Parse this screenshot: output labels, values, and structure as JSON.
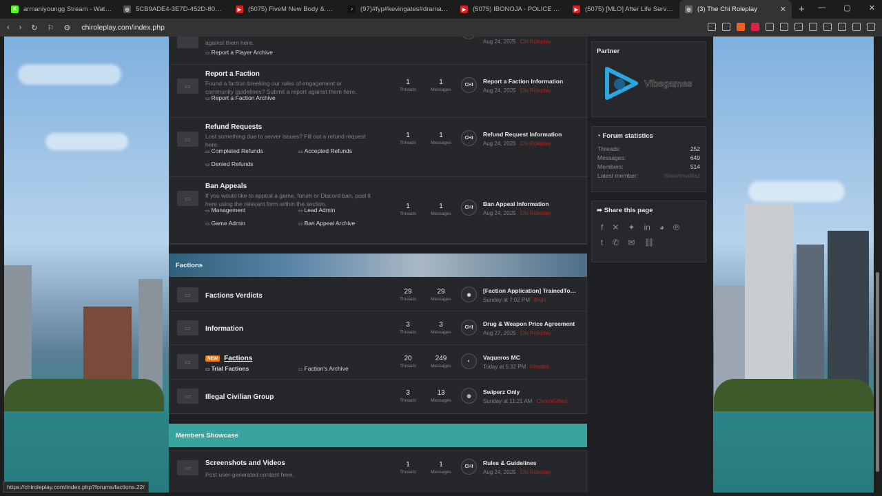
{
  "tabs": [
    {
      "title": "armaniyoungg Stream - Watch L",
      "fav_color": "#53fc18",
      "fav_text": "K",
      "muted": true
    },
    {
      "title": "5CB9ADE4-3E7D-452D-80EE-7A93E",
      "fav_color": "#555",
      "fav_text": "◎"
    },
    {
      "title": "(5075) FiveM New Body & Mask Co",
      "fav_color": "#e02020",
      "fav_text": "▶"
    },
    {
      "title": "(97)#fyp#kevingates#drama | Kevin",
      "fav_color": "#111",
      "fav_text": "♪"
    },
    {
      "title": "(5075) IBONOJA - POLICE ACADEMY",
      "fav_color": "#e02020",
      "fav_text": "▶"
    },
    {
      "title": "(5075) [MLO] After Life Services - Fi",
      "fav_color": "#e02020",
      "fav_text": "▶"
    },
    {
      "title": "(3) The Chi Roleplay",
      "fav_color": "#666",
      "fav_text": "◎",
      "active": true
    }
  ],
  "url": "chiroleplay.com/index.php",
  "status_url": "https://chiroleplay.com/index.php?forums/factions.22/",
  "stat_labels": {
    "threads": "Threads",
    "messages": "Messages"
  },
  "top_partial": {
    "desc": "against them here.",
    "sub": "Report a Player Archive",
    "date": "Aug 24, 2025",
    "user": "Chi Roleplay"
  },
  "nodes": [
    {
      "title": "Report a Faction",
      "desc": "Found a faction breaking our rules of engagement or community guidelines? Submit a report against them here.",
      "subs": [
        "Report a Faction Archive"
      ],
      "threads": "1",
      "messages": "1",
      "last_title": "Report a Faction Information",
      "last_date": "Aug 24, 2025",
      "last_user": "Chi Roleplay"
    },
    {
      "title": "Refund Requests",
      "desc": "Lost something due to server issues? Fill out a refund request here.",
      "subs": [
        "Completed Refunds",
        "Accepted Refunds",
        "Denied Refunds"
      ],
      "threads": "1",
      "messages": "1",
      "last_title": "Refund Request Information",
      "last_date": "Aug 24, 2025",
      "last_user": "Chi Roleplay"
    },
    {
      "title": "Ban Appeals",
      "desc": "If you would like to appeal a game, forum or Discord ban, post it here using the relevant form within the section.",
      "subs": [
        "Management",
        "Lead Admin",
        "Game Admin",
        "Ban Appeal Archive"
      ],
      "threads": "1",
      "messages": "1",
      "last_title": "Ban Appeal Information",
      "last_date": "Aug 24, 2025",
      "last_user": "Chi Roleplay"
    }
  ],
  "factions_header": "Factions",
  "faction_nodes": [
    {
      "title": "Factions Verdicts",
      "threads": "29",
      "messages": "29",
      "last_title": "[Faction Application] TrainedToDrill...",
      "last_date": "Sunday at 7:02 PM",
      "last_user": "Bnjlli"
    },
    {
      "title": "Information",
      "threads": "3",
      "messages": "3",
      "last_title": "Drug & Weapon Price Agreement",
      "last_date": "Aug 27, 2025",
      "last_user": "Chi Roleplay"
    },
    {
      "title": "Factions",
      "badge": "NEW",
      "subs": [
        "Trial Factions",
        "Faction's Archive"
      ],
      "threads": "20",
      "messages": "249",
      "last_title": "Vaqueros MC",
      "last_date": "Today at 5:32 PM",
      "last_user": "Rhodes"
    },
    {
      "title": "Illegal Civilian Group",
      "threads": "3",
      "messages": "13",
      "last_title": "Swiperz Only",
      "last_date": "Sunday at 11:21 AM",
      "last_user": "ChocoGifted"
    }
  ],
  "showcase_header": "Members Showcase",
  "showcase_nodes": [
    {
      "title": "Screenshots and Videos",
      "desc": "Post user-generated content here.",
      "threads": "1",
      "messages": "1",
      "last_title": "Rules & Guidelines",
      "last_date": "Aug 24, 2025",
      "last_user": "Chi Roleplay"
    }
  ],
  "sidebar": {
    "partner_title": "Partner",
    "partner_name": "Vibegames",
    "stats_title": "Forum statistics",
    "stats": [
      {
        "label": "Threads:",
        "value": "252"
      },
      {
        "label": "Messages:",
        "value": "649"
      },
      {
        "label": "Members:",
        "value": "514"
      },
      {
        "label": "Latest member:",
        "value": "ShowtimaNaz"
      }
    ],
    "share_title": "Share this page"
  }
}
